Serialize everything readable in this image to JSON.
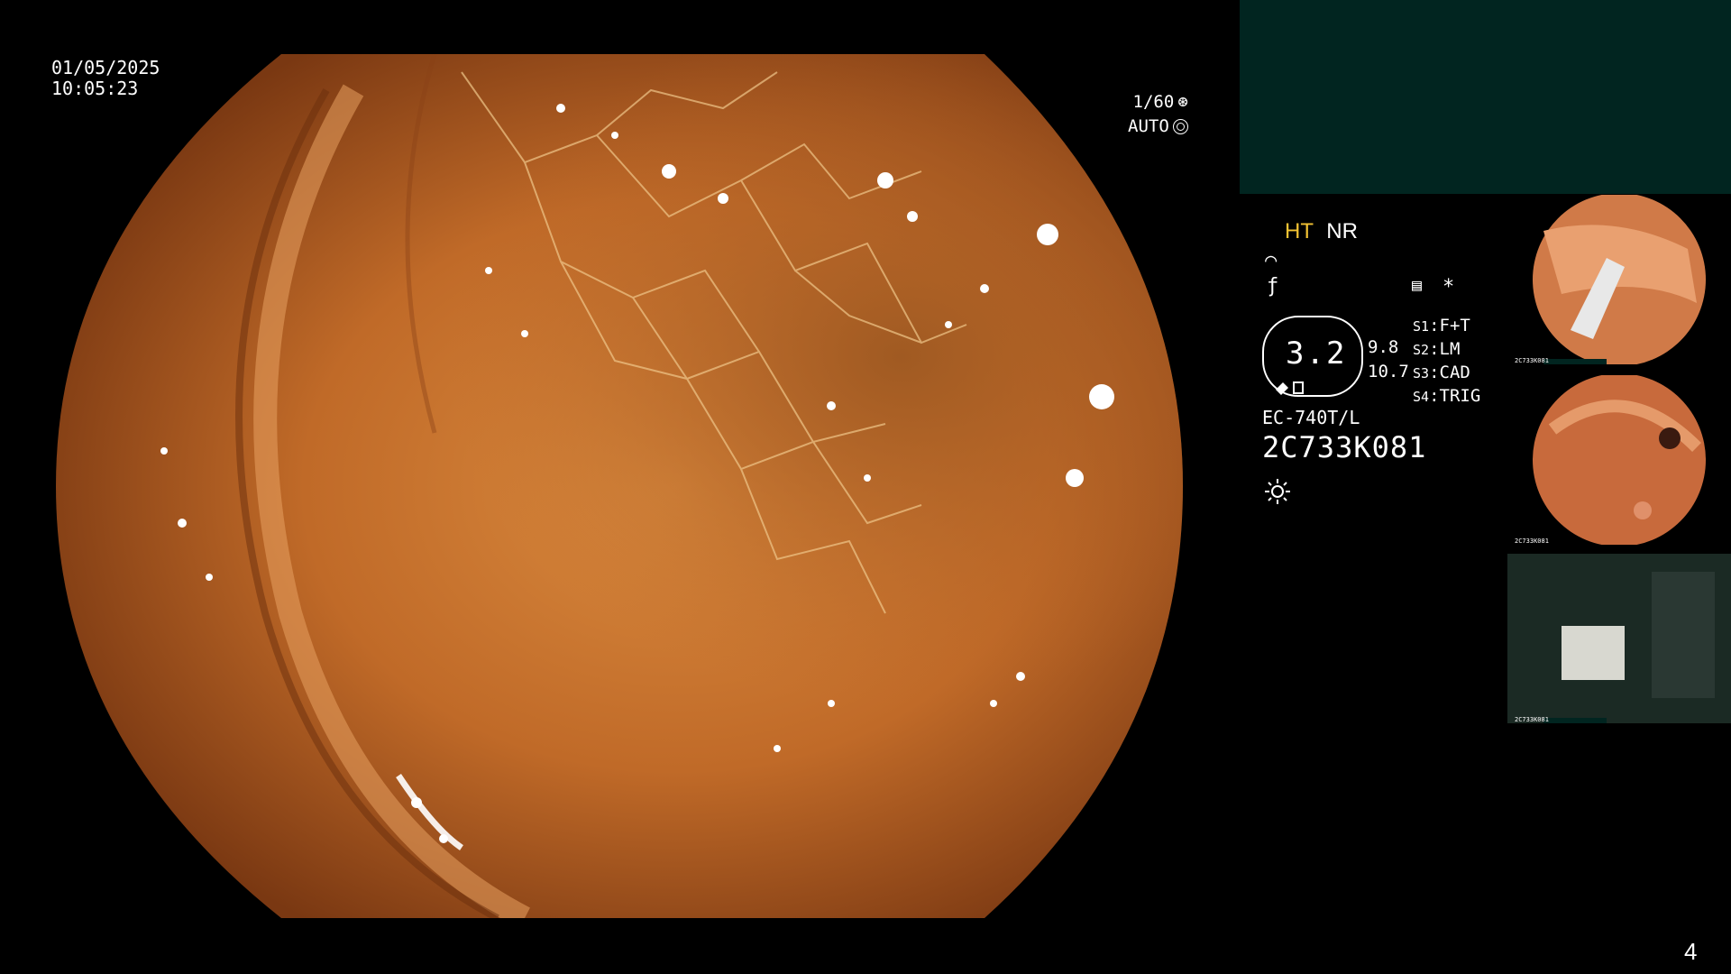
{
  "overlay": {
    "date": "01/05/2025",
    "time": "10:05:23",
    "shutter": "1/60",
    "exposure_mode": "AUTO"
  },
  "settings": {
    "mode_ht": "HT",
    "mode_nr": "NR",
    "scope_value": "3.2",
    "value_1": "9.8",
    "value_2": "10.7",
    "slots": [
      {
        "key": "S1",
        "value": "F+T"
      },
      {
        "key": "S2",
        "value": "LM"
      },
      {
        "key": "S3",
        "value": "CAD"
      },
      {
        "key": "S4",
        "value": "TRIG"
      }
    ],
    "endoscope_model": "EC-740T/L",
    "serial_number": "2C733K081"
  },
  "thumbnails": [
    {
      "label": "2C733K081"
    },
    {
      "label": "2C733K081"
    },
    {
      "label": "2C733K081"
    }
  ],
  "page_number": "4",
  "colors": {
    "panel_teal": "#012520",
    "ht_yellow": "#f2c233",
    "tissue_orange": "#c8742c"
  }
}
